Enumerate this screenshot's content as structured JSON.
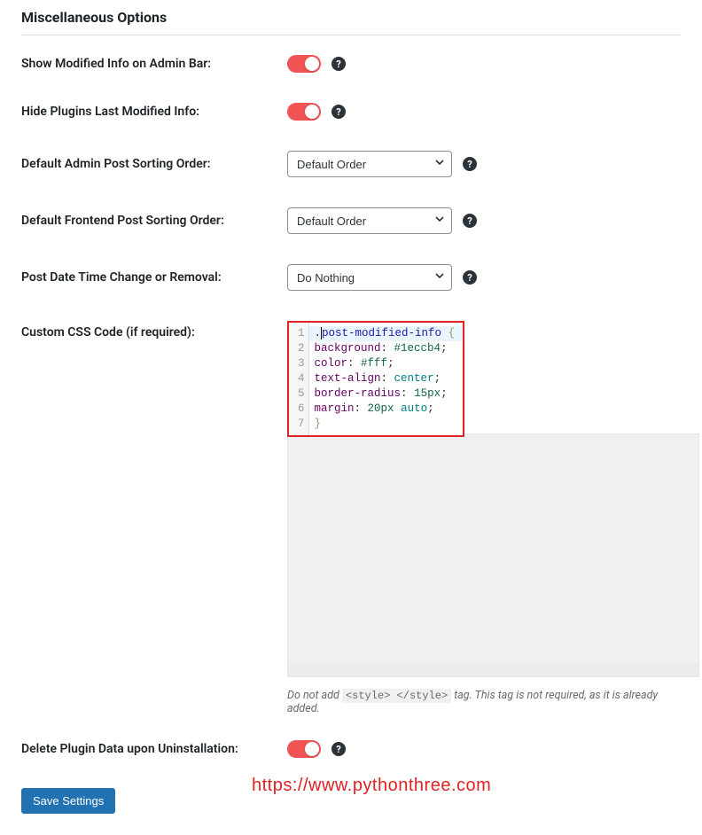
{
  "section_title": "Miscellaneous Options",
  "rows": {
    "show_modified_admin_bar": {
      "label": "Show Modified Info on Admin Bar:",
      "on": true
    },
    "hide_plugins_last_modified": {
      "label": "Hide Plugins Last Modified Info:",
      "on": true
    },
    "default_admin_sort": {
      "label": "Default Admin Post Sorting Order:",
      "value": "Default Order"
    },
    "default_frontend_sort": {
      "label": "Default Frontend Post Sorting Order:",
      "value": "Default Order"
    },
    "post_date_change": {
      "label": "Post Date Time Change or Removal:",
      "value": "Do Nothing"
    },
    "custom_css": {
      "label": "Custom CSS Code (if required):",
      "lines": [
        ".post-modified-info {",
        "background: #1eccb4;",
        "color: #fff;",
        "text-align: center;",
        "border-radius: 15px;",
        "margin: 20px auto;",
        "}"
      ],
      "active_line": 1,
      "note_prefix": "Do not add ",
      "note_code": "<style> </style>",
      "note_suffix": " tag. This tag is not required, as it is already added."
    },
    "delete_on_uninstall": {
      "label": "Delete Plugin Data upon Uninstallation:",
      "on": true
    }
  },
  "save_button": "Save Settings",
  "watermark": "https://www.pythonthree.com",
  "help_glyph": "?"
}
